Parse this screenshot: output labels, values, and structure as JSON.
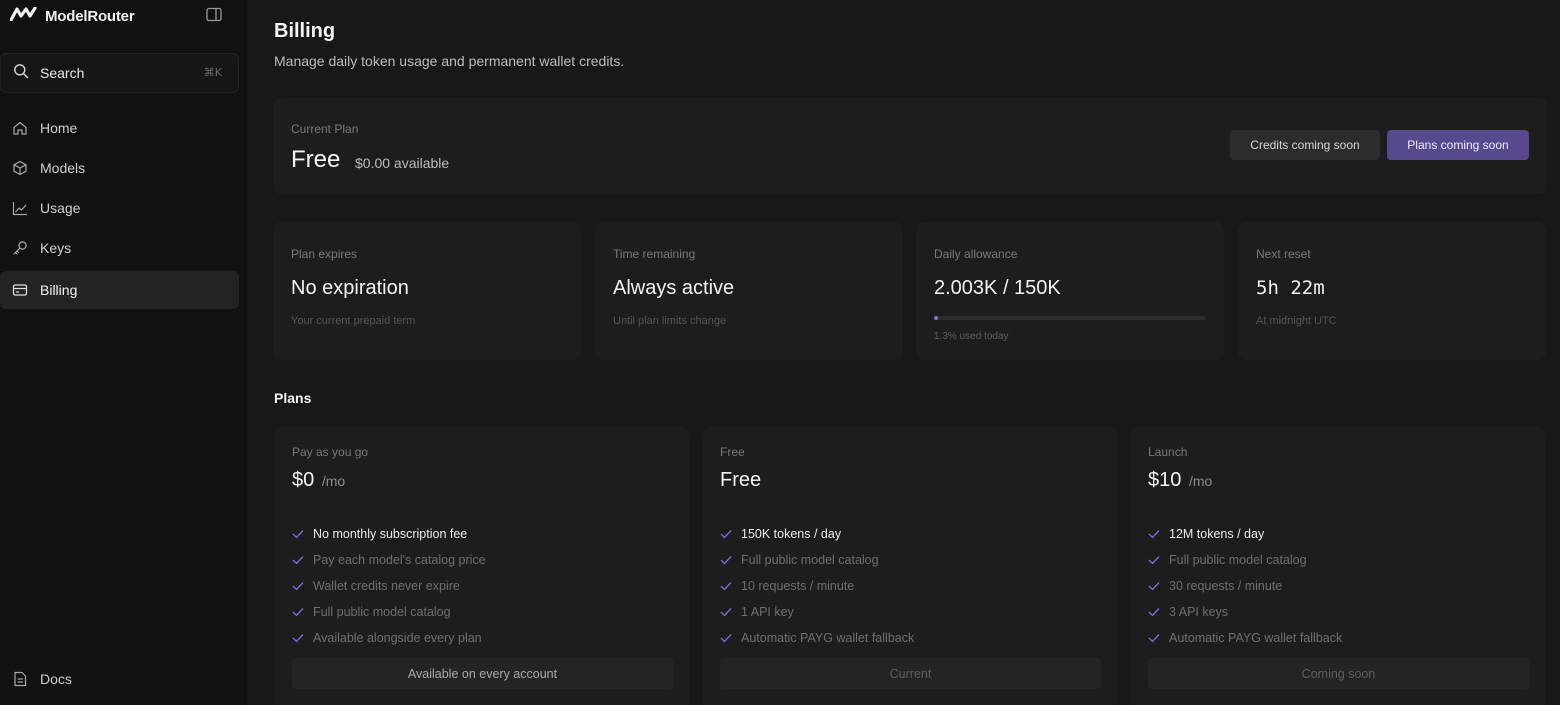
{
  "app": {
    "name": "ModelRouter"
  },
  "sidebar": {
    "search": {
      "label": "Search",
      "shortcut": "⌘K"
    },
    "items": [
      {
        "label": "Home",
        "icon": "home-icon"
      },
      {
        "label": "Models",
        "icon": "cube-icon"
      },
      {
        "label": "Usage",
        "icon": "chart-line-icon"
      },
      {
        "label": "Keys",
        "icon": "key-icon"
      },
      {
        "label": "Billing",
        "icon": "credit-card-icon",
        "active": true
      }
    ],
    "docs": {
      "label": "Docs",
      "icon": "document-icon"
    }
  },
  "header": {
    "title": "Billing",
    "subtitle": "Manage daily token usage and permanent wallet credits."
  },
  "current_plan": {
    "label": "Current Plan",
    "name": "Free",
    "available": "$0.00 available",
    "credits_button": "Credits coming soon",
    "plans_button": "Plans coming soon"
  },
  "stats": [
    {
      "label": "Plan expires",
      "value": "No expiration",
      "note": "Your current prepaid term"
    },
    {
      "label": "Time remaining",
      "value": "Always active",
      "note": "Until plan limits change"
    },
    {
      "label": "Daily allowance",
      "value": "2.003K / 150K",
      "progress_pct": 1.3,
      "note": "1.3% used today"
    },
    {
      "label": "Next reset",
      "value": "5h 22m",
      "note": "At midnight UTC"
    }
  ],
  "plans_section": {
    "title": "Plans"
  },
  "plans": [
    {
      "label": "Pay as you go",
      "price": "$0",
      "period": "/mo",
      "features": [
        "No monthly subscription fee",
        "Pay each model's catalog price",
        "Wallet credits never expire",
        "Full public model catalog",
        "Available alongside every plan"
      ],
      "button": "Available on every account"
    },
    {
      "label": "Free",
      "price": "Free",
      "period": "",
      "features": [
        "150K tokens / day",
        "Full public model catalog",
        "10 requests / minute",
        "1 API key",
        "Automatic PAYG wallet fallback"
      ],
      "button": "Current"
    },
    {
      "label": "Launch",
      "price": "$10",
      "period": "/mo",
      "features": [
        "12M tokens / day",
        "Full public model catalog",
        "30 requests / minute",
        "3 API keys",
        "Automatic PAYG wallet fallback"
      ],
      "button": "Coming soon"
    }
  ],
  "colors": {
    "accent": "#58498e",
    "progress": "#7d6fdc",
    "check": "#7d6fdc"
  }
}
